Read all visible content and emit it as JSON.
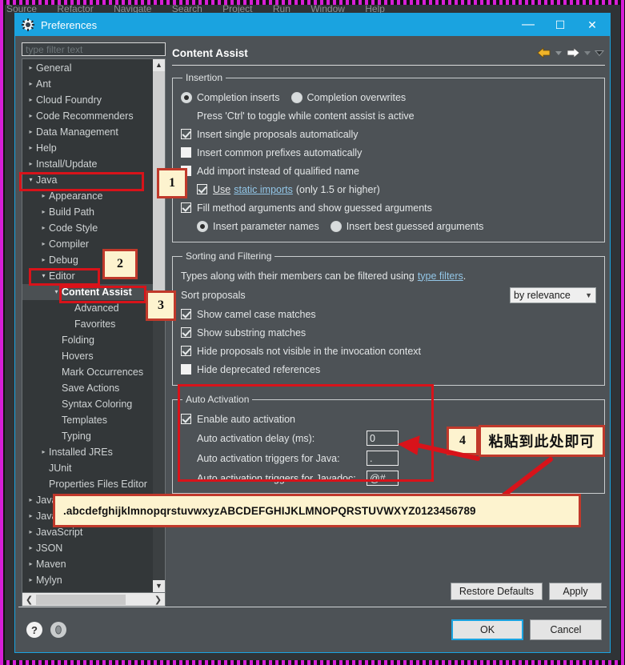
{
  "ide": {
    "menubar": [
      "Source",
      "Refactor",
      "Navigate",
      "Search",
      "Project",
      "Run",
      "Window",
      "Help"
    ]
  },
  "dialog": {
    "title": "Preferences",
    "icon": "gear-icon",
    "window_buttons": {
      "minimize": "—",
      "maximize": "☐",
      "close": "✕"
    }
  },
  "sidebar": {
    "filter_placeholder": "type filter text",
    "items": [
      {
        "label": "General",
        "indent": 0,
        "state": "collapsed"
      },
      {
        "label": "Ant",
        "indent": 0,
        "state": "collapsed"
      },
      {
        "label": "Cloud Foundry",
        "indent": 0,
        "state": "collapsed"
      },
      {
        "label": "Code Recommenders",
        "indent": 0,
        "state": "collapsed"
      },
      {
        "label": "Data Management",
        "indent": 0,
        "state": "collapsed"
      },
      {
        "label": "Help",
        "indent": 0,
        "state": "collapsed"
      },
      {
        "label": "Install/Update",
        "indent": 0,
        "state": "collapsed"
      },
      {
        "label": "Java",
        "indent": 0,
        "state": "expanded"
      },
      {
        "label": "Appearance",
        "indent": 1,
        "state": "collapsed"
      },
      {
        "label": "Build Path",
        "indent": 1,
        "state": "collapsed"
      },
      {
        "label": "Code Style",
        "indent": 1,
        "state": "collapsed"
      },
      {
        "label": "Compiler",
        "indent": 1,
        "state": "collapsed"
      },
      {
        "label": "Debug",
        "indent": 1,
        "state": "collapsed"
      },
      {
        "label": "Editor",
        "indent": 1,
        "state": "expanded"
      },
      {
        "label": "Content Assist",
        "indent": 2,
        "state": "expanded",
        "selected": true
      },
      {
        "label": "Advanced",
        "indent": 3,
        "state": "leaf"
      },
      {
        "label": "Favorites",
        "indent": 3,
        "state": "leaf"
      },
      {
        "label": "Folding",
        "indent": 2,
        "state": "leaf"
      },
      {
        "label": "Hovers",
        "indent": 2,
        "state": "leaf"
      },
      {
        "label": "Mark Occurrences",
        "indent": 2,
        "state": "leaf"
      },
      {
        "label": "Save Actions",
        "indent": 2,
        "state": "leaf"
      },
      {
        "label": "Syntax Coloring",
        "indent": 2,
        "state": "leaf"
      },
      {
        "label": "Templates",
        "indent": 2,
        "state": "leaf"
      },
      {
        "label": "Typing",
        "indent": 2,
        "state": "leaf"
      },
      {
        "label": "Installed JREs",
        "indent": 1,
        "state": "collapsed"
      },
      {
        "label": "JUnit",
        "indent": 1,
        "state": "leaf"
      },
      {
        "label": "Properties Files Editor",
        "indent": 1,
        "state": "leaf"
      },
      {
        "label": "Java EE",
        "indent": 0,
        "state": "collapsed"
      },
      {
        "label": "Java Persistence",
        "indent": 0,
        "state": "collapsed"
      },
      {
        "label": "JavaScript",
        "indent": 0,
        "state": "collapsed"
      },
      {
        "label": "JSON",
        "indent": 0,
        "state": "collapsed"
      },
      {
        "label": "Maven",
        "indent": 0,
        "state": "collapsed"
      },
      {
        "label": "Mylyn",
        "indent": 0,
        "state": "collapsed"
      }
    ],
    "scroll_up_icon": "chevron-up-icon",
    "scroll_down_icon": "chevron-down-icon",
    "scroll_left_icon": "chevron-left-icon",
    "scroll_right_icon": "chevron-right-icon"
  },
  "page": {
    "title": "Content Assist",
    "nav": {
      "back_icon": "arrow-left-icon",
      "back_menu_icon": "chevron-down-icon",
      "forward_icon": "arrow-right-icon",
      "forward_menu_icon": "chevron-down-icon",
      "more_icon": "chevron-down-icon"
    }
  },
  "insertion": {
    "legend": "Insertion",
    "completion_inserts": "Completion inserts",
    "completion_overwrites": "Completion overwrites",
    "hint": "Press 'Ctrl' to toggle while content assist is active",
    "insert_single": "Insert single proposals automatically",
    "insert_prefixes": "Insert common prefixes automatically",
    "add_import": "Add import instead of qualified name",
    "use_label": "Use",
    "static_imports_link": "static imports",
    "static_imports_suffix": "(only 1.5 or higher)",
    "fill_method_args": "Fill method arguments and show guessed arguments",
    "insert_param_names": "Insert parameter names",
    "insert_best_guessed": "Insert best guessed arguments"
  },
  "sorting": {
    "legend": "Sorting and Filtering",
    "types_prefix": "Types along with their members can be filtered using",
    "type_filters_link": "type filters",
    "types_suffix": ".",
    "sort_proposals_label": "Sort proposals",
    "sort_value": "by relevance",
    "sort_chevron": "chevron-down-icon",
    "show_camel": "Show camel case matches",
    "show_substring": "Show substring matches",
    "hide_not_visible": "Hide proposals not visible in the invocation context",
    "hide_deprecated": "Hide deprecated references"
  },
  "auto_activation": {
    "legend": "Auto Activation",
    "enable": "Enable auto activation",
    "delay_label": "Auto activation delay (ms):",
    "delay_value": "0",
    "java_label": "Auto activation triggers for Java:",
    "java_value": ".",
    "javadoc_label": "Auto activation triggers for Javadoc:",
    "javadoc_value": "@#"
  },
  "buttons": {
    "restore_defaults": "Restore Defaults",
    "apply": "Apply",
    "ok": "OK",
    "cancel": "Cancel"
  },
  "footer": {
    "help_icon": "question-mark-icon",
    "pin_icon": "pin-icon"
  },
  "annotations": {
    "marker1": "1",
    "marker2": "2",
    "marker3": "3",
    "marker4": "4",
    "note_cn": "粘贴到此处即可",
    "note_string": ".abcdefghijklmnopqrstuvwxyzABCDEFGHIJKLMNOPQRSTUVWXYZ0123456789"
  },
  "colors": {
    "accent": "#1aa3e0",
    "annotation_red": "#d8131a",
    "annotation_fill": "#fdf3cf",
    "dialog_bg": "#4d5256",
    "tree_bg": "#333739"
  }
}
